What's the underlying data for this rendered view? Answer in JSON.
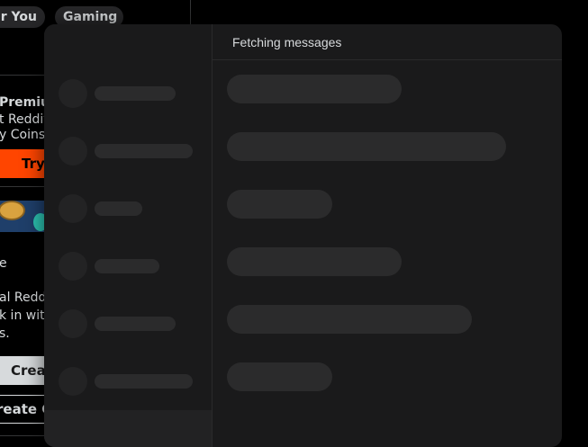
{
  "background_page": {
    "chips": [
      "ar You",
      "Gaming"
    ],
    "premium": {
      "title": "Premium",
      "lines": [
        "t Reddit",
        "y Coins"
      ],
      "try_label": "Try"
    },
    "home": {
      "title": "e",
      "lines": [
        "al Reddi",
        "k in wit",
        "s."
      ],
      "create_post_label": "Creat",
      "create_community_label": "reate C"
    }
  },
  "chat": {
    "header_status": "Fetching messages",
    "colors": {
      "panel": "#1a1a1b",
      "skeleton": "#2b2b2c",
      "accent": "#ff4500"
    }
  }
}
